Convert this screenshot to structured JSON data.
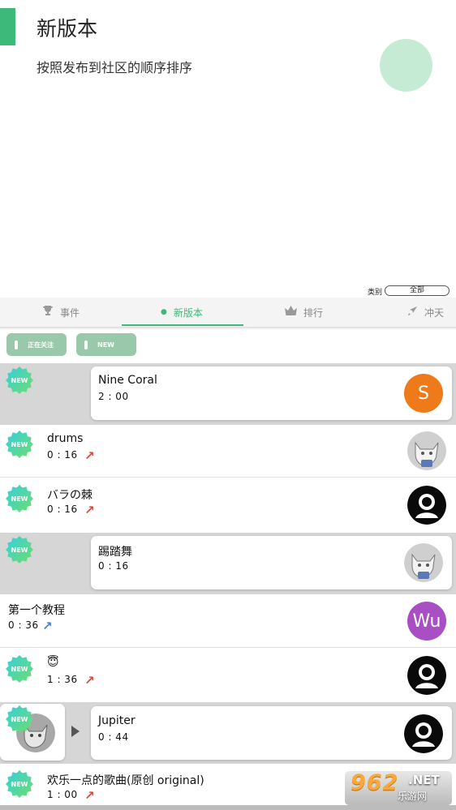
{
  "header": {
    "title": "新版本",
    "subtitle": "按照发布到社区的顺序排序",
    "accent_color": "#3dba79"
  },
  "filter": {
    "label": "类别",
    "value": "全部"
  },
  "tabs": [
    {
      "label": "事件",
      "icon": "trophy-icon"
    },
    {
      "label": "新版本",
      "icon": "dot-icon",
      "active": true
    },
    {
      "label": "排行",
      "icon": "crown-icon"
    },
    {
      "label": "冲天",
      "icon": "rocket-icon"
    }
  ],
  "chips": [
    {
      "label": "正在关注"
    },
    {
      "label": "NEW"
    }
  ],
  "badge_text": "NEW",
  "songs": [
    {
      "title": "Nine Coral",
      "duration": "2 : 00",
      "avatar_letter": "S",
      "avatar_color": "#ef7a1a",
      "style": "card",
      "new": true
    },
    {
      "title": "drums",
      "duration": "0 : 16",
      "avatar": "cat-avatar",
      "style": "plain",
      "new": true,
      "trend": "up-arrow-icon"
    },
    {
      "title": "バラの棘",
      "duration": "0 : 16",
      "avatar": "default-user-avatar",
      "style": "plain",
      "new": true,
      "trend": "up-arrow-icon"
    },
    {
      "title": "踢踏舞",
      "duration": "0 : 16",
      "avatar": "cat-avatar",
      "style": "card",
      "new": true
    },
    {
      "title": "第一个教程",
      "duration": "0 : 36",
      "avatar_letter": "Wu",
      "avatar_color": "#a84fc4",
      "style": "plain",
      "new": false,
      "trend": "up-arrow-icon"
    },
    {
      "title": "😇",
      "duration": "1 : 36",
      "avatar": "default-user-avatar",
      "style": "plain",
      "new": true,
      "trend": "up-arrow-icon"
    },
    {
      "title": "Jupiter",
      "duration": "0 : 44",
      "avatar": "default-user-avatar",
      "style": "card-play",
      "new": true
    },
    {
      "title": "欢乐一点的歌曲(原创 original)",
      "duration": "1 : 00",
      "avatar": "default-user-avatar",
      "style": "plain",
      "new": true,
      "trend": "up-arrow-icon"
    }
  ],
  "watermark": {
    "number": "962",
    "suffix": ".NET",
    "cn": "乐游网"
  }
}
